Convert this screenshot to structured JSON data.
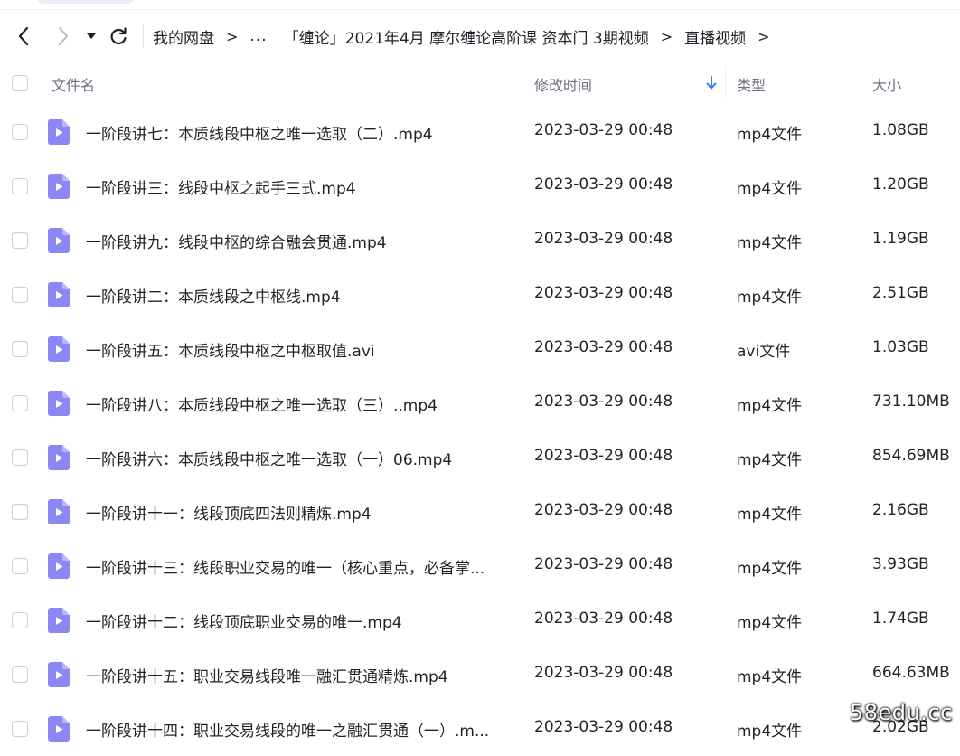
{
  "nav": {
    "breadcrumb": {
      "root": "我的网盘",
      "ellipsis": "...",
      "folder": "「缠论」2021年4月 摩尔缠论高阶课 资本门 3期视频",
      "current": "直播视频",
      "separator": ">"
    }
  },
  "header": {
    "name": "文件名",
    "modified": "修改时间",
    "type": "类型",
    "size": "大小"
  },
  "files": [
    {
      "name": "一阶段讲七：本质线段中枢之唯一选取（二）.mp4",
      "time": "2023-03-29 00:48",
      "type": "mp4文件",
      "size": "1.08GB"
    },
    {
      "name": "一阶段讲三：线段中枢之起手三式.mp4",
      "time": "2023-03-29 00:48",
      "type": "mp4文件",
      "size": "1.20GB"
    },
    {
      "name": "一阶段讲九：线段中枢的综合融会贯通.mp4",
      "time": "2023-03-29 00:48",
      "type": "mp4文件",
      "size": "1.19GB"
    },
    {
      "name": "一阶段讲二：本质线段之中枢线.mp4",
      "time": "2023-03-29 00:48",
      "type": "mp4文件",
      "size": "2.51GB"
    },
    {
      "name": "一阶段讲五：本质线段中枢之中枢取值.avi",
      "time": "2023-03-29 00:48",
      "type": "avi文件",
      "size": "1.03GB"
    },
    {
      "name": "一阶段讲八：本质线段中枢之唯一选取（三）..mp4",
      "time": "2023-03-29 00:48",
      "type": "mp4文件",
      "size": "731.10MB"
    },
    {
      "name": "一阶段讲六：本质线段中枢之唯一选取（一）06.mp4",
      "time": "2023-03-29 00:48",
      "type": "mp4文件",
      "size": "854.69MB"
    },
    {
      "name": "一阶段讲十一：线段顶底四法则精炼.mp4",
      "time": "2023-03-29 00:48",
      "type": "mp4文件",
      "size": "2.16GB"
    },
    {
      "name": "一阶段讲十三：线段职业交易的唯一（核心重点，必备掌...",
      "time": "2023-03-29 00:48",
      "type": "mp4文件",
      "size": "3.93GB"
    },
    {
      "name": "一阶段讲十二：线段顶底职业交易的唯一.mp4",
      "time": "2023-03-29 00:48",
      "type": "mp4文件",
      "size": "1.74GB"
    },
    {
      "name": "一阶段讲十五：职业交易线段唯一融汇贯通精炼.mp4",
      "time": "2023-03-29 00:48",
      "type": "mp4文件",
      "size": "664.63MB"
    },
    {
      "name": "一阶段讲十四：职业交易线段的唯一之融汇贯通（一）.m...",
      "time": "2023-03-29 00:48",
      "type": "mp4文件",
      "size": "2.02GB"
    }
  ],
  "colors": {
    "video_icon": "#8b87f5",
    "sort_arrow": "#2f80ed",
    "text": "#1f2329",
    "header_text": "#6b7280"
  },
  "watermark": "58edu.cc"
}
